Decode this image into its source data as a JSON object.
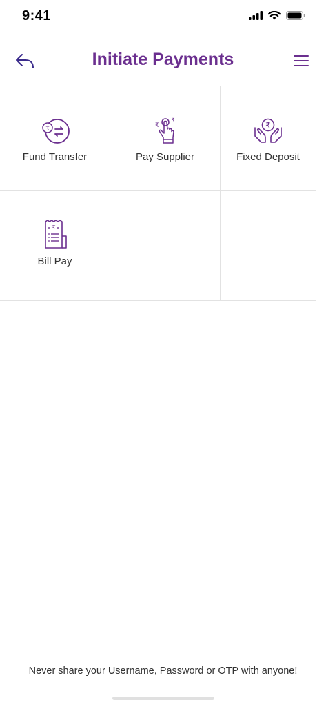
{
  "status_bar": {
    "time": "9:41"
  },
  "header": {
    "title": "Initiate Payments",
    "back_icon": "reply-arrow-icon",
    "menu_icon": "hamburger-menu-icon"
  },
  "tiles": [
    {
      "label": "Fund Transfer",
      "icon": "rupee-transfer-icon"
    },
    {
      "label": "Pay Supplier",
      "icon": "hand-tap-rupee-icon"
    },
    {
      "label": "Fixed Deposit",
      "icon": "hands-rupee-coin-icon"
    },
    {
      "label": "Bill Pay",
      "icon": "receipt-icon"
    }
  ],
  "footer": {
    "note": "Never share your Username, Password or OTP with anyone!"
  },
  "colors": {
    "brand": "#6b2f8f",
    "divider": "#e2e2e2",
    "text": "#333333"
  }
}
